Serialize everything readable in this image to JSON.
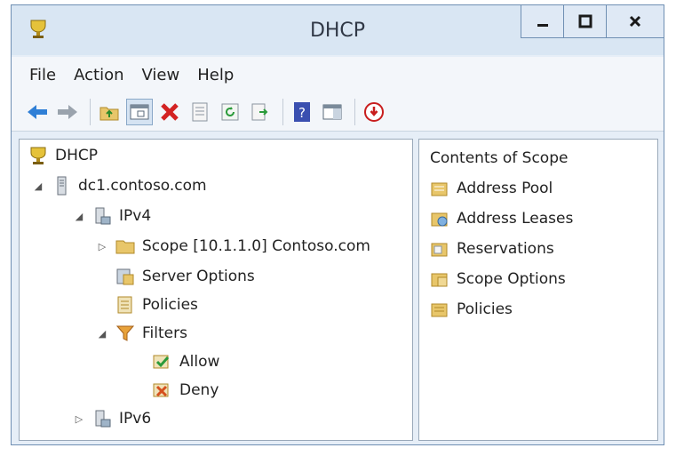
{
  "window": {
    "title": "DHCP"
  },
  "titlebar_buttons": {
    "minimize_icon": "minimize-icon",
    "maximize_icon": "maximize-icon",
    "close_icon": "close-icon"
  },
  "menu": [
    "File",
    "Action",
    "View",
    "Help"
  ],
  "toolbar": {
    "icons": [
      "back-arrow-icon",
      "forward-arrow-icon",
      "up-folder-icon",
      "console-view-icon",
      "delete-icon",
      "properties-icon",
      "refresh-icon",
      "export-list-icon",
      "help-icon",
      "show-hide-pane-icon",
      "deactivate-icon"
    ]
  },
  "tree": {
    "root": "DHCP",
    "server": "dc1.contoso.com",
    "ipv4": "IPv4",
    "scope": "Scope [10.1.1.0] Contoso.com",
    "server_options": "Server Options",
    "policies": "Policies",
    "filters": "Filters",
    "allow": "Allow",
    "deny": "Deny",
    "ipv6": "IPv6"
  },
  "details": {
    "header": "Contents of Scope",
    "items": [
      "Address Pool",
      "Address Leases",
      "Reservations",
      "Scope Options",
      "Policies"
    ]
  },
  "colors": {
    "window_border": "#6f8fb3",
    "titlebar": "#d9e6f3",
    "folder": "#e8c66a",
    "delete_red": "#d32222"
  }
}
